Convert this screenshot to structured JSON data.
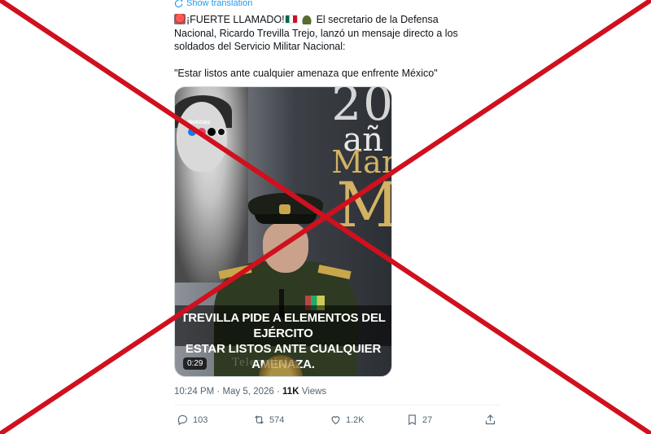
{
  "translate_link": "Show translation",
  "tweet": {
    "line1": "¡FUERTE LLAMADO!",
    "line1_rest": " El secretario de la Defensa Nacional, Ricardo Trevilla Trejo, lanzó un mensaje directo a los soldados del Servicio Militar Nacional:",
    "quote": "\"Estar listos ante cualquier amenaza que enfrente México\""
  },
  "media": {
    "bg_number": "20",
    "bg_word1": "añ",
    "bg_word2": "Mar",
    "bg_word3": "M",
    "logo_text": "Noticias",
    "caption_line1": "TREVILLA PIDE A ELEMENTOS DEL EJÉRCITO",
    "caption_line2": "ESTAR LISTOS ANTE CUALQUIER AMENAZA.",
    "watermark": "Telenoticias",
    "duration": "0:29"
  },
  "meta": {
    "time": "10:24 PM",
    "separator": "·",
    "date": "May 5, 2026",
    "views_count": "11K",
    "views_label": "Views"
  },
  "actions": {
    "reply_count": "103",
    "retweet_count": "574",
    "like_count": "1.2K",
    "bookmark_count": "27"
  },
  "colors": {
    "link": "#1d9bf0",
    "muted": "#536471",
    "text": "#0f1419",
    "cross": "#d0101e"
  },
  "icons": [
    "translate-icon",
    "siren-emoji-icon",
    "mexico-flag-icon",
    "helmet-emoji-icon",
    "reply-icon",
    "retweet-icon",
    "heart-icon",
    "bookmark-icon",
    "share-icon"
  ]
}
